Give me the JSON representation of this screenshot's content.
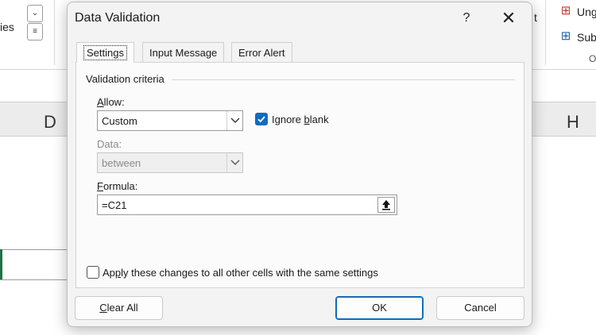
{
  "background": {
    "ribbon": {
      "partial_label_left": "ies",
      "right_items": [
        {
          "label": "Ung",
          "icon": "ungroup-icon"
        },
        {
          "label": "Sub",
          "icon": "subtotal-icon"
        }
      ],
      "partial_group_letter": "O",
      "partial_text_mid": "t"
    },
    "columns": [
      "D",
      "H"
    ]
  },
  "dialog": {
    "title": "Data Validation",
    "help_label": "?",
    "close_label": "✕",
    "tabs": [
      {
        "label": "Settings",
        "active": true
      },
      {
        "label": "Input Message",
        "active": false
      },
      {
        "label": "Error Alert",
        "active": false
      }
    ],
    "validation_criteria_label": "Validation criteria",
    "allow": {
      "label_u": "A",
      "label_rest": "llow:",
      "value": "Custom"
    },
    "ignore_blank": {
      "label_pre": "Ignore ",
      "label_u": "b",
      "label_rest": "lank",
      "checked": true
    },
    "data": {
      "label": "Data:",
      "value": "between",
      "disabled": true
    },
    "formula": {
      "label_u": "F",
      "label_rest": "ormula:",
      "value": "=C21"
    },
    "apply_all": {
      "label_pre": "Ap",
      "label_u": "p",
      "label_rest": "ly these changes to all other cells with the same settings",
      "checked": false
    },
    "buttons": {
      "clear_all": {
        "label_u": "C",
        "label_rest": "lear All"
      },
      "ok": "OK",
      "cancel": "Cancel"
    },
    "colors": {
      "accent": "#0f6cbd",
      "sheet_selection": "#1e7145"
    }
  }
}
